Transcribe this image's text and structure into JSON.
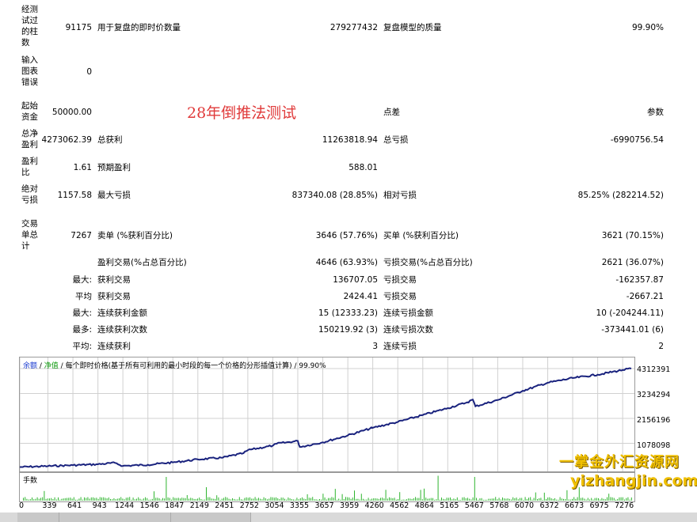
{
  "stamp_text": "28年倒推法测试",
  "rows": {
    "bars": {
      "label": "经测试过的柱数",
      "value": "91175",
      "l2": "用于复盘的即时价数量",
      "v2": "279277432",
      "l3": "复盘模型的质量",
      "v3": "99.90%"
    },
    "errors": {
      "label": "输入图表错误",
      "value": "0"
    },
    "deposit": {
      "label": "起始资金",
      "value": "50000.00",
      "l3": "点差",
      "v3": "参数"
    },
    "net_profit": {
      "label": "总净盈利",
      "value": "4273062.39",
      "l2": "总获利",
      "v2": "11263818.94",
      "l3": "总亏损",
      "v3": "-6990756.54"
    },
    "profit_factor": {
      "label": "盈利比",
      "value": "1.61",
      "l2": "预期盈利",
      "v2": "588.01"
    },
    "abs_drawdown": {
      "label": "绝对亏损",
      "value": "1157.58",
      "l2": "最大亏损",
      "v2": "837340.08 (28.85%)",
      "l3": "相对亏损",
      "v3": "85.25% (282214.52)"
    },
    "trades": {
      "label": "交易单总计",
      "value": "7267",
      "l2": "卖单 (%获利百分比)",
      "v2": "3646 (57.76%)",
      "l3": "买单 (%获利百分比)",
      "v3": "3621 (70.15%)"
    },
    "win_loss": {
      "l2": "盈利交易(%占总百分比)",
      "v2": "4646 (63.93%)",
      "l3": "亏损交易(%占总百分比)",
      "v3": "2621 (36.07%)"
    },
    "largest": {
      "prefix": "最大:",
      "l2": "获利交易",
      "v2": "136707.05",
      "l3": "亏损交易",
      "v3": "-162357.87"
    },
    "average": {
      "prefix": "平均",
      "l2": "获利交易",
      "v2": "2424.41",
      "l3": "亏损交易",
      "v3": "-2667.21"
    },
    "max_consec_amount": {
      "prefix": "最大:",
      "l2": "连续获利金额",
      "v2": "15 (12333.23)",
      "l3": "连续亏损金额",
      "v3": "10 (-204244.11)"
    },
    "max_consec_count": {
      "prefix": "最多:",
      "l2": "连续获利次数",
      "v2": "150219.92 (3)",
      "l3": "连续亏损次数",
      "v3": "-373441.01 (6)"
    },
    "avg_consec": {
      "prefix": "平均:",
      "l2": "连续获利",
      "v2": "3",
      "l3": "连续亏损",
      "v3": "2"
    }
  },
  "chart_legend": {
    "balance": "余额",
    "sep1": " / ",
    "equity": "净值",
    "sep2": " / ",
    "text": "每个即时价格(基于所有可利用的最小时段的每一个价格的分形插值计算) / 99.90%"
  },
  "volume_title": "手数",
  "watermark_line1": "一掌金外汇资源网",
  "watermark_line2": "yizhangjin.com",
  "chart_data": {
    "type": "line",
    "series": [
      {
        "x": [
          0,
          339,
          641,
          943,
          1150,
          1244,
          1546,
          1847,
          2149,
          2451,
          2700,
          2752,
          3054,
          3100,
          3355,
          3380,
          3657,
          3959,
          4260,
          4562,
          4864,
          5165,
          5400,
          5467,
          5500,
          5768,
          6070,
          6372,
          6673,
          6975,
          7276,
          7380
        ],
        "values": [
          50000,
          90000,
          130000,
          170000,
          230000,
          100000,
          150000,
          250000,
          380000,
          460000,
          650000,
          780000,
          980000,
          1060000,
          1180000,
          920000,
          1120000,
          1420000,
          1750000,
          2000000,
          2300000,
          2600000,
          2850000,
          2970000,
          2680000,
          2950000,
          3350000,
          3700000,
          3900000,
          4050000,
          4250000,
          4312391
        ]
      }
    ],
    "y_ticks": [
      "4312391",
      "3234294",
      "2156196",
      "1078098"
    ],
    "x_ticks": [
      "0",
      "339",
      "641",
      "943",
      "1244",
      "1546",
      "1847",
      "2149",
      "2451",
      "2752",
      "3054",
      "3355",
      "3657",
      "3959",
      "4260",
      "4562",
      "4864",
      "5165",
      "5467",
      "5768",
      "6070",
      "6372",
      "6673",
      "6975",
      "7276"
    ],
    "xlim": [
      0,
      7380
    ],
    "ylim": [
      0,
      4312391
    ],
    "grid": true,
    "colors": {
      "balance": "#1a237e",
      "volume": "#2fb52f",
      "grid": "#d0d0d0"
    }
  }
}
